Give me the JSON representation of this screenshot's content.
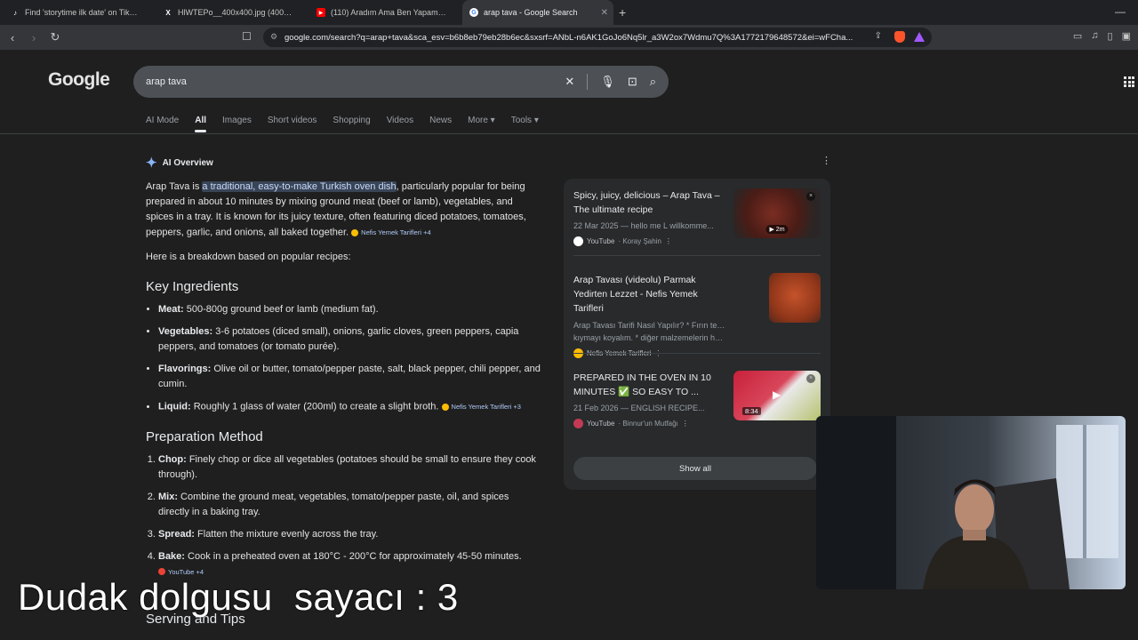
{
  "browser": {
    "tabs": [
      {
        "title": "Find 'storytime ilk date' on TikTok | T",
        "icon": "tiktok-icon",
        "color": "#ffffff"
      },
      {
        "title": "HlWTEPo__400x400.jpg (400×400)",
        "icon": "x-icon",
        "color": "#ffffff"
      },
      {
        "title": "(110) Aradım Ama Ben Yapamam - Y",
        "icon": "youtube-icon",
        "color": "#ff0000"
      },
      {
        "title": "arap tava - Google Search",
        "icon": "google-icon",
        "color": "#4285f4"
      }
    ],
    "url": "google.com/search?q=arap+tava&sca_esv=b6b8eb79eb28b6ec&sxsrf=ANbL-n6AK1GoJo6Nq5lr_a3W2ox7Wdmu7Q%3A1772179648572&ei=wFCha..."
  },
  "google": {
    "logo": "Google",
    "query": "arap tava",
    "tabs": [
      "AI Mode",
      "All",
      "Images",
      "Short videos",
      "Shopping",
      "Videos",
      "News",
      "More ▾",
      "Tools ▾"
    ]
  },
  "aio": {
    "heading": "AI Overview",
    "intro_pre": "Arap Tava is ",
    "intro_hl": "a traditional, easy-to-make Turkish oven dish",
    "intro_post": ", particularly popular for being prepared in about 10 minutes by mixing ground meat (beef or lamb), vegetables, and spices in a tray. It is known for its juicy texture, often featuring diced potatoes, tomatoes, peppers, garlic, and onions, all baked together.",
    "intro_chip": "Nefis Yemek Tarifleri +4",
    "breakdown": "Here is a breakdown based on popular recipes:",
    "ingredients_heading": "Key Ingredients",
    "ingredients": [
      {
        "k": "Meat:",
        "v": " 500-800g ground beef or lamb (medium fat)."
      },
      {
        "k": "Vegetables:",
        "v": " 3-6 potatoes (diced small), onions, garlic cloves, green peppers, capia peppers, and tomatoes (or tomato purée)."
      },
      {
        "k": "Flavorings:",
        "v": " Olive oil or butter, tomato/pepper paste, salt, black pepper, chili pepper, and cumin."
      },
      {
        "k": "Liquid:",
        "v": " Roughly 1 glass of water (200ml) to create a slight broth."
      }
    ],
    "liquid_chip": "Nefis Yemek Tarifleri +3",
    "method_heading": "Preparation Method",
    "method": [
      {
        "k": "Chop:",
        "v": " Finely chop or dice all vegetables (potatoes should be small to ensure they cook through)."
      },
      {
        "k": "Mix:",
        "v": " Combine the ground meat, vegetables, tomato/pepper paste, oil, and spices directly in a baking tray."
      },
      {
        "k": "Spread:",
        "v": " Flatten the mixture evenly across the tray."
      },
      {
        "k": "Bake:",
        "v": " Cook in a preheated oven at 180°C - 200°C for approximately 45-50 minutes."
      }
    ],
    "bake_chip": "YouTube +4",
    "serving_heading": "Serving and Tips"
  },
  "sources": [
    {
      "title": "Spicy, juicy, delicious – Arap Tava – The ultimate recipe",
      "snippet": "22 Mar 2025 — hello me L willkomme...",
      "site": "YouTube",
      "sub": "· Koray Şahin",
      "badge": "▶ 2m",
      "thumb_color": "#5b2a22"
    },
    {
      "title": "Arap Tavası (videolu) Parmak Yedirten Lezzet - Nefis Yemek Tarifleri",
      "snippet": "Arap Tavası Tarifi Nasıl Yapılır? * Fırın tepsisine",
      "snippet2": "kıymayı koyalım. * diğer malzemelerin hepsini...",
      "site": "Nefis Yemek Tarifleri",
      "sub": "",
      "thumb_color": "#9c3a1e"
    },
    {
      "title": "PREPARED IN THE OVEN IN 10 MINUTES ✅ SO EASY TO ...",
      "snippet": "21 Feb 2026 — ENGLISH RECIPE...",
      "site": "YouTube",
      "sub": "· Binnur'un Mutfağı",
      "duration": "8:34",
      "thumb_color": "#b3263a"
    }
  ],
  "show_all": "Show all",
  "overlay": {
    "caption": "Dudak dolgusu  sayacı : 3"
  }
}
